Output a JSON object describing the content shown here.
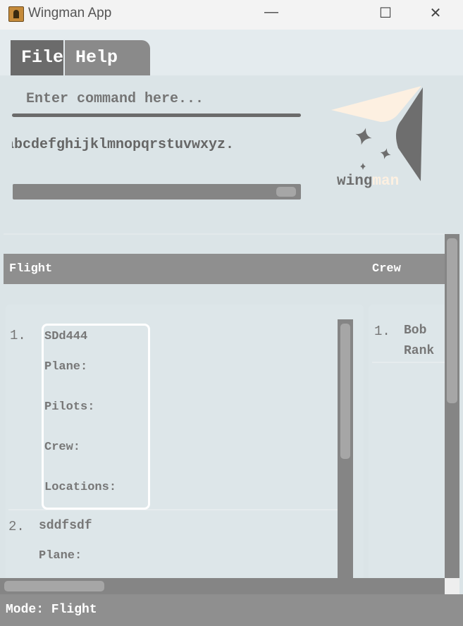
{
  "window": {
    "title": "Wingman App",
    "minimize": "—",
    "maximize": "☐",
    "close": "✕"
  },
  "menu": {
    "items": [
      {
        "label": "File"
      },
      {
        "label": "Help"
      }
    ]
  },
  "command": {
    "placeholder": "Enter command here...",
    "value": ""
  },
  "result": {
    "text": "abcdefghijklmnopqrstuvwxyz."
  },
  "logo": {
    "text_dark": "wing",
    "text_light": "man",
    "colors": {
      "dark": "#6e6e6e",
      "light": "#fdf0e1"
    }
  },
  "headers": {
    "flight": "Flight",
    "crew": "Crew"
  },
  "flights": [
    {
      "index": "1.",
      "code": "SDd444",
      "plane": "Plane:",
      "pilots": "Pilots:",
      "crew": "Crew:",
      "locations": "Locations:"
    },
    {
      "index": "2.",
      "code": "sddfsdf",
      "plane": "Plane:"
    }
  ],
  "crew": [
    {
      "index": "1.",
      "name": "Bob",
      "rank": "Rank"
    }
  ],
  "status": {
    "mode": "Mode: Flight"
  }
}
